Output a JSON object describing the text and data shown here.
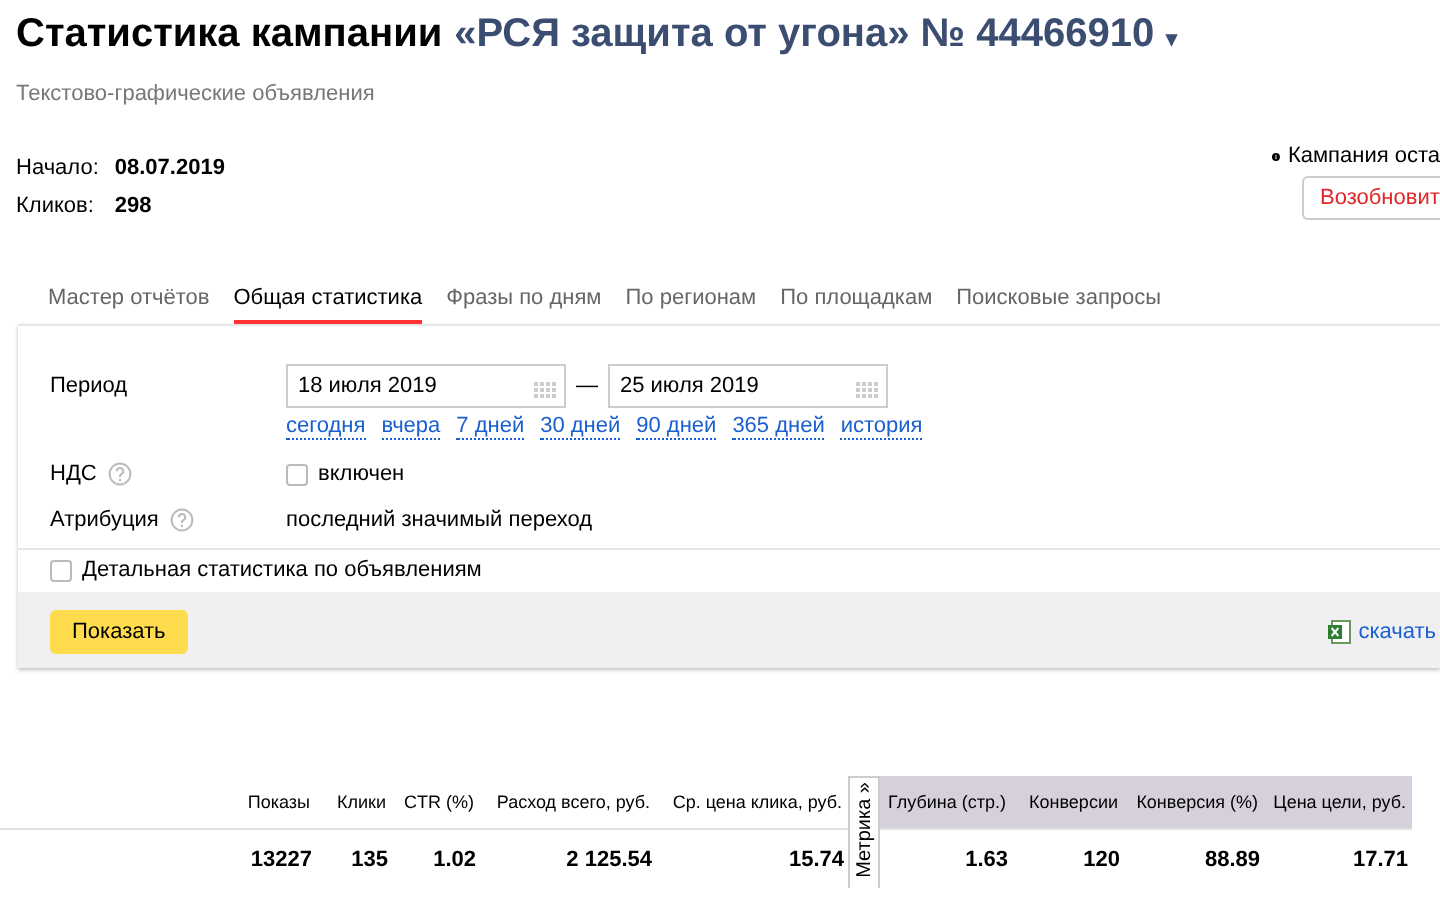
{
  "header": {
    "title": "Статистика кампании",
    "campaign": "«РСЯ защита от угона» № 44466910",
    "caret": "▾",
    "subtitle": "Текстово-графические объявления"
  },
  "summary": [
    {
      "label": "Начало:",
      "value": "08.07.2019"
    },
    {
      "label": "Кликов:",
      "value": "298"
    }
  ],
  "status": {
    "message": "Кампания оста",
    "button": "Возобновит"
  },
  "tabs": [
    {
      "label": "Мастер отчётов",
      "selected": false
    },
    {
      "label": "Общая статистика",
      "selected": true
    },
    {
      "label": "Фразы по дням",
      "selected": false
    },
    {
      "label": "По регионам",
      "selected": false
    },
    {
      "label": "По площадкам",
      "selected": false
    },
    {
      "label": "Поисковые запросы",
      "selected": false
    }
  ],
  "form": {
    "period": {
      "label": "Период",
      "from": "18 июля 2019",
      "separator": "—",
      "to": "25 июля 2019",
      "presets": [
        "сегодня",
        "вчера",
        "7 дней",
        "30 дней",
        "90 дней",
        "365 дней",
        "история"
      ]
    },
    "vat": {
      "label": "НДС",
      "checked": false,
      "option": "включен"
    },
    "attribution": {
      "label": "Атрибуция",
      "value": "последний значимый переход"
    },
    "detailed": {
      "label": "Детальная статистика по объявлениям",
      "checked": false
    },
    "submit": "Показать",
    "download": "скачать"
  },
  "table": {
    "metrika_label": "Метрика »",
    "columns": [
      {
        "label": "Показы",
        "shaded": false
      },
      {
        "label": "Клики",
        "shaded": false
      },
      {
        "label": "CTR (%)",
        "shaded": false
      },
      {
        "label": "Расход всего, руб.",
        "shaded": false
      },
      {
        "label": "Ср. цена клика, руб.",
        "shaded": false
      },
      {
        "label": "Глубина (стр.)",
        "shaded": true
      },
      {
        "label": "Конверсии",
        "shaded": true
      },
      {
        "label": "Конверсия (%)",
        "shaded": true
      },
      {
        "label": "Цена цели, руб.",
        "shaded": true
      }
    ],
    "rows": [
      [
        "13227",
        "135",
        "1.02",
        "2 125.54",
        "15.74",
        "1.63",
        "120",
        "88.89",
        "17.71"
      ]
    ]
  }
}
